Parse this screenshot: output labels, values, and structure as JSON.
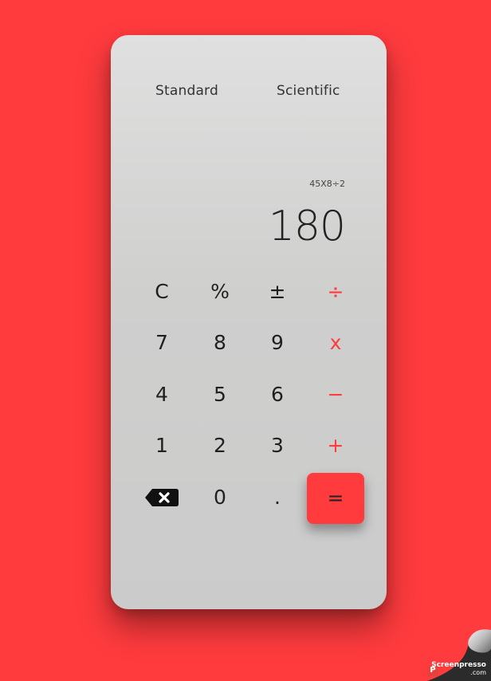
{
  "tabs": {
    "standard": "Standard",
    "scientific": "Scientific"
  },
  "display": {
    "expression": "45X8÷2",
    "result": "180"
  },
  "keys": {
    "clear": "C",
    "percent": "%",
    "plus_minus": "±",
    "divide": "÷",
    "seven": "7",
    "eight": "8",
    "nine": "9",
    "multiply": "x",
    "four": "4",
    "five": "5",
    "six": "6",
    "minus": "−",
    "one": "1",
    "two": "2",
    "three": "3",
    "plus": "+",
    "zero": "0",
    "decimal": ".",
    "equals": "="
  },
  "icons": {
    "backspace": "backspace-icon"
  },
  "colors": {
    "background": "#ff3b3e",
    "accent": "#ff3b3e",
    "panel": "#d3d3d2",
    "text": "#1f1f1f"
  },
  "watermark": {
    "brand": "Screenpresso",
    "domain": ".com"
  }
}
